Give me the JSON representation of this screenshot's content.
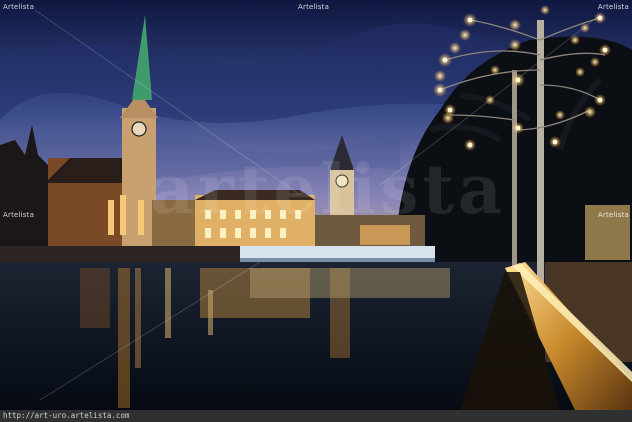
{
  "watermarks": {
    "top_left": "Artelista",
    "top_center": "Artelista",
    "top_right": "Artelista",
    "mid_left": "Artelista",
    "mid_right": "Artelista",
    "center_logo": "artelista"
  },
  "footer": {
    "url": "http://art-uro.artelista.com"
  },
  "colors": {
    "sky_top": "#0f1740",
    "sky_mid": "#3a4c8a",
    "sky_horizon": "#8a86b8",
    "water": "#0a1420",
    "lights": "#ffd27a",
    "footer_bg": "#2f3031"
  }
}
